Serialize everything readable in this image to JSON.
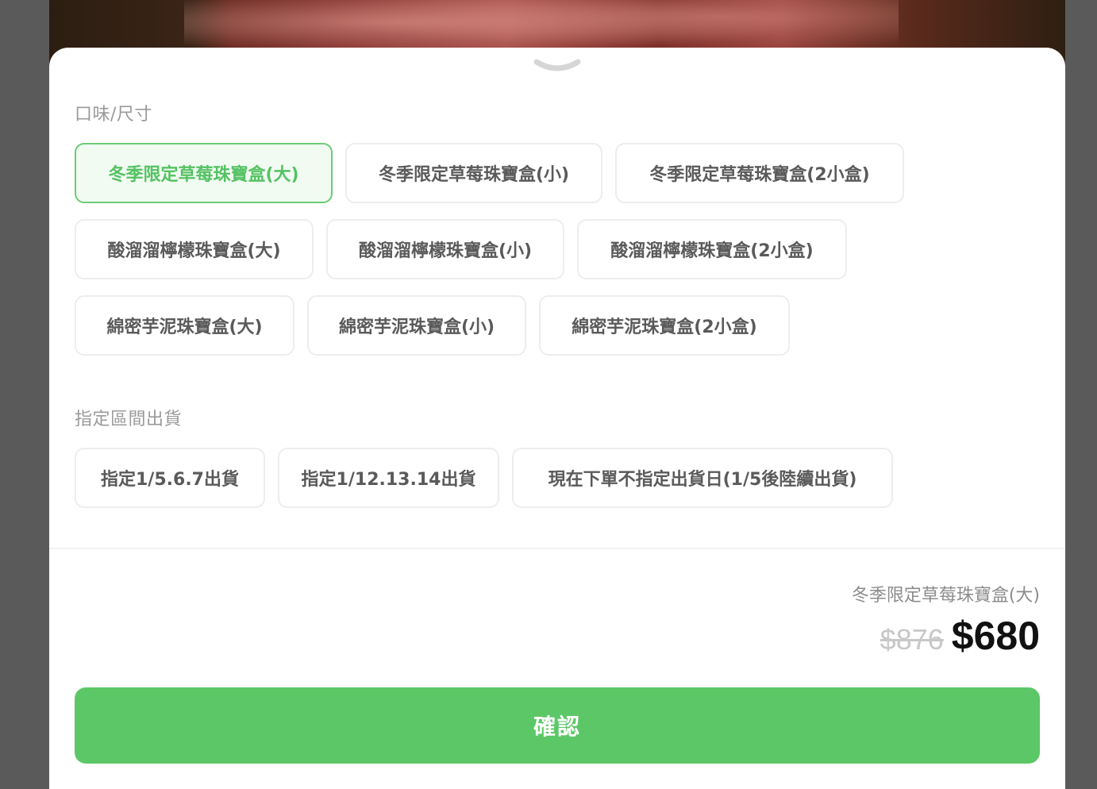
{
  "sheet": {
    "flavor_label": "口味/尺寸",
    "flavor_options": [
      {
        "label": "冬季限定草莓珠寶盒(大)",
        "selected": true
      },
      {
        "label": "冬季限定草莓珠寶盒(小)",
        "selected": false
      },
      {
        "label": "冬季限定草莓珠寶盒(2小盒)",
        "selected": false
      },
      {
        "label": "酸溜溜檸檬珠寶盒(大)",
        "selected": false
      },
      {
        "label": "酸溜溜檸檬珠寶盒(小)",
        "selected": false
      },
      {
        "label": "酸溜溜檸檬珠寶盒(2小盒)",
        "selected": false
      },
      {
        "label": "綿密芋泥珠寶盒(大)",
        "selected": false
      },
      {
        "label": "綿密芋泥珠寶盒(小)",
        "selected": false
      },
      {
        "label": "綿密芋泥珠寶盒(2小盒)",
        "selected": false
      }
    ],
    "shipping_label": "指定區間出貨",
    "shipping_options": [
      {
        "label": "指定1/5.6.7出貨",
        "selected": false
      },
      {
        "label": "指定1/12.13.14出貨",
        "selected": false
      },
      {
        "label": "現在下單不指定出貨日(1/5後陸續出貨)",
        "selected": false
      }
    ]
  },
  "summary": {
    "selected_name": "冬季限定草莓珠寶盒(大)",
    "original_price": "$876",
    "final_price": "$680"
  },
  "confirm_label": "確認",
  "colors": {
    "accent": "#5cc767",
    "selected_border": "#6ccb76",
    "selected_bg": "#f1fbf2"
  }
}
